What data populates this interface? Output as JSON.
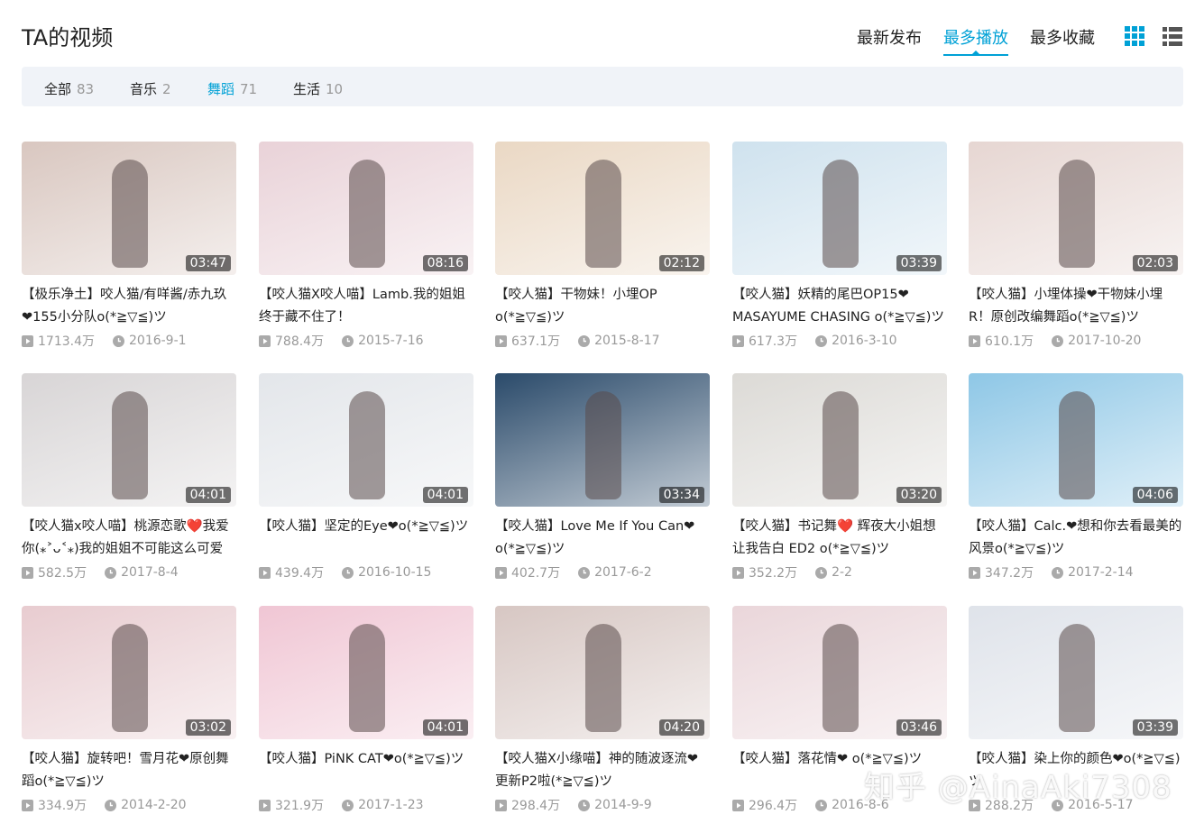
{
  "header": {
    "title": "TA的视频"
  },
  "order_tabs": [
    {
      "label": "最新发布",
      "active": false
    },
    {
      "label": "最多播放",
      "active": true
    },
    {
      "label": "最多收藏",
      "active": false
    }
  ],
  "view_modes": [
    {
      "icon": "grid-view-icon",
      "active": true,
      "color": "#00a1d6"
    },
    {
      "icon": "list-view-icon",
      "active": false,
      "color": "#555555"
    }
  ],
  "filters": [
    {
      "label": "全部",
      "count": "83",
      "active": false
    },
    {
      "label": "音乐",
      "count": "2",
      "active": false
    },
    {
      "label": "舞蹈",
      "count": "71",
      "active": true
    },
    {
      "label": "生活",
      "count": "10",
      "active": false
    }
  ],
  "videos": [
    {
      "title": "【极乐净土】咬人猫/有咩酱/赤九玖❤155小分队o(*≧▽≦)ツ",
      "duration": "03:47",
      "plays": "1713.4万",
      "date": "2016-9-1",
      "color": "#d9c7c0"
    },
    {
      "title": "【咬人猫X咬人喵】Lamb.我的姐姐终于藏不住了！",
      "duration": "08:16",
      "plays": "788.4万",
      "date": "2015-7-16",
      "color": "#e9d2d8"
    },
    {
      "title": "【咬人猫】干物妹！小埋OP o(*≧▽≦)ツ",
      "duration": "02:12",
      "plays": "637.1万",
      "date": "2015-8-17",
      "color": "#ead8c4"
    },
    {
      "title": "【咬人猫】妖精的尾巴OP15❤MASAYUME CHASING o(*≧▽≦)ツ",
      "duration": "03:39",
      "plays": "617.3万",
      "date": "2016-3-10",
      "color": "#cfe2ee"
    },
    {
      "title": "【咬人猫】小埋体操❤干物妹小埋R！原创改编舞蹈o(*≧▽≦)ツ",
      "duration": "02:03",
      "plays": "610.1万",
      "date": "2017-10-20",
      "color": "#e6d6d2"
    },
    {
      "title": "【咬人猫x咬人喵】桃源恋歌❤️我爱你(⁎˃ᴗ˂⁎)我的姐姐不可能这么可爱",
      "duration": "04:01",
      "plays": "582.5万",
      "date": "2017-8-4",
      "color": "#d8d5d6"
    },
    {
      "title": "【咬人猫】坚定的Eye❤o(*≧▽≦)ツ",
      "duration": "04:01",
      "plays": "439.4万",
      "date": "2016-10-15",
      "color": "#e3e6ea"
    },
    {
      "title": "【咬人猫】Love Me If You Can❤o(*≧▽≦)ツ",
      "duration": "03:34",
      "plays": "402.7万",
      "date": "2017-6-2",
      "color": "#2a4a6a"
    },
    {
      "title": "【咬人猫】书记舞❤️ 辉夜大小姐想让我告白 ED2 o(*≧▽≦)ツ",
      "duration": "03:20",
      "plays": "352.2万",
      "date": "2-2",
      "color": "#dcdad6"
    },
    {
      "title": "【咬人猫】Calc.❤想和你去看最美的风景o(*≧▽≦)ツ",
      "duration": "04:06",
      "plays": "347.2万",
      "date": "2017-2-14",
      "color": "#8ec7e6"
    },
    {
      "title": "【咬人猫】旋转吧！雪月花❤原创舞蹈o(*≧▽≦)ツ",
      "duration": "03:02",
      "plays": "334.9万",
      "date": "2014-2-20",
      "color": "#e8ccd0"
    },
    {
      "title": "【咬人猫】PiNK CAT❤o(*≧▽≦)ツ",
      "duration": "04:01",
      "plays": "321.9万",
      "date": "2017-1-23",
      "color": "#f0c6d4"
    },
    {
      "title": "【咬人猫X小缘喵】神的随波逐流❤更新P2啦(*≧▽≦)ツ",
      "duration": "04:20",
      "plays": "298.4万",
      "date": "2014-9-9",
      "color": "#d7c7c3"
    },
    {
      "title": "【咬人猫】落花情❤ o(*≧▽≦)ツ",
      "duration": "03:46",
      "plays": "296.4万",
      "date": "2016-8-6",
      "color": "#ead6da"
    },
    {
      "title": "【咬人猫】染上你的颜色❤o(*≧▽≦)ツ",
      "duration": "03:39",
      "plays": "288.2万",
      "date": "2016-5-17",
      "color": "#dfe3ea"
    }
  ],
  "watermark": "知乎 @AinaAki7308"
}
